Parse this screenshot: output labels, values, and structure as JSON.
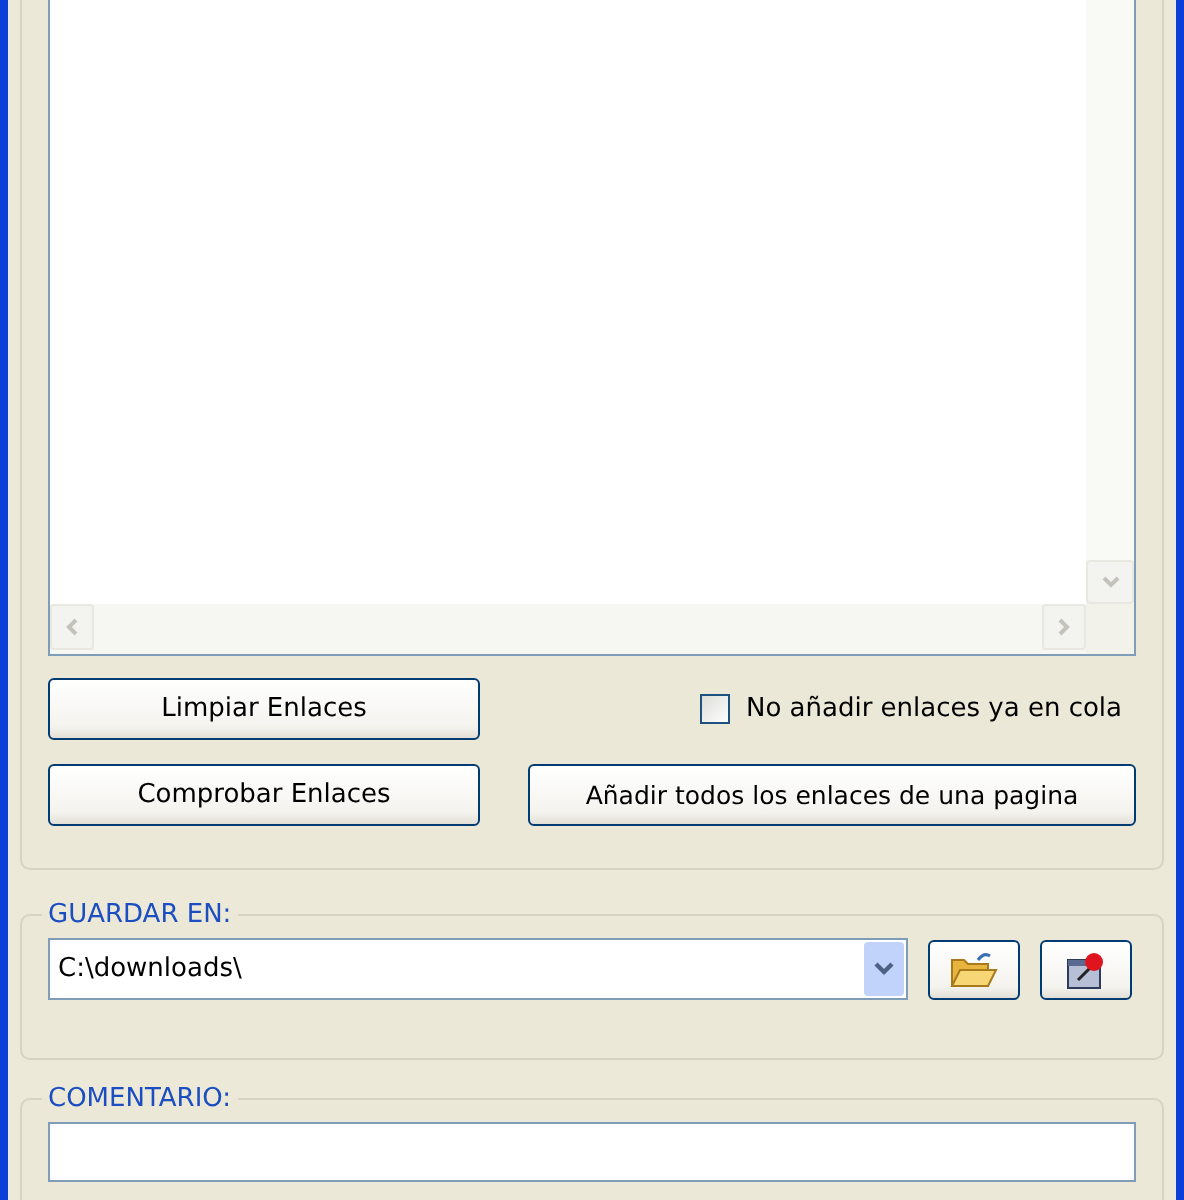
{
  "links_panel": {
    "buttons": [
      {
        "kind": "clear",
        "label": "Limpiar Enlaces"
      },
      {
        "kind": "check",
        "label": "Comprobar Enlaces"
      },
      {
        "kind": "add_all",
        "label": "Añadir todos los enlaces de una pagina"
      }
    ],
    "skip_queued": {
      "label": "No añadir enlaces ya en cola",
      "checked": false
    }
  },
  "save_to": {
    "legend": "GUARDAR EN:",
    "path": "C:\\downloads\\"
  },
  "comment": {
    "legend": "COMENTARIO:"
  }
}
